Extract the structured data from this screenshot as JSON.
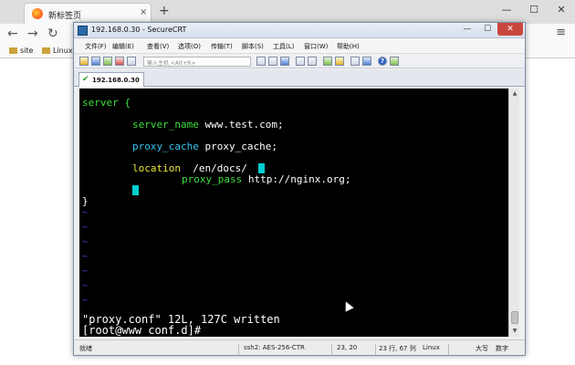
{
  "browser": {
    "tab_title": "新标签页",
    "tab_close": "×",
    "new_tab": "+",
    "nav_back": "←",
    "nav_forward": "→",
    "nav_reload": "↻",
    "menu": "≡",
    "bookmarks": [
      {
        "label": "site"
      },
      {
        "label": "Linux-"
      }
    ],
    "win_min": "—",
    "win_max": "☐",
    "win_close": "✕"
  },
  "crt": {
    "title": "192.168.0.30 - SecureCRT",
    "win_min": "—",
    "win_max": "☐",
    "win_close": "✕",
    "menu": [
      "文件(F)",
      "编辑(E)",
      "查看(V)",
      "选项(O)",
      "传输(T)",
      "脚本(S)",
      "工具(L)",
      "窗口(W)",
      "帮助(H)"
    ],
    "host_placeholder": "输入主机 <Alt+R>",
    "help_icon_text": "?",
    "session_tab": "192.168.0.30",
    "session_check": "✔"
  },
  "terminal": {
    "line1": "server {",
    "line2_key": "server_name",
    "line2_val": " www.test.com;",
    "line3_key": "proxy_cache",
    "line3_val": " proxy_cache;",
    "line4_key": "location",
    "line4_val": "  /en/docs/ ",
    "line5_key": "proxy_pass",
    "line5_val": " http://nginx.org;",
    "line6": "}",
    "tilde": "~",
    "status_line": "\"proxy.conf\" 12L, 127C written",
    "prompt": "[root@www conf.d]#"
  },
  "statusbar": {
    "ready": "就绪",
    "cipher": "ssh2: AES-256-CTR",
    "position": "23,  20",
    "rows_cols": "23 行, 67 列",
    "os": "Linux",
    "caps": "大写",
    "num": "数字"
  },
  "colors": {
    "terminal_bg": "#000000",
    "keyword_green": "#3ede3e",
    "directive_cyan": "#35c2ef",
    "location_yellow": "#e8e83a",
    "tilde_blue": "#4848e0",
    "cursor_cyan": "#00cfcf"
  }
}
